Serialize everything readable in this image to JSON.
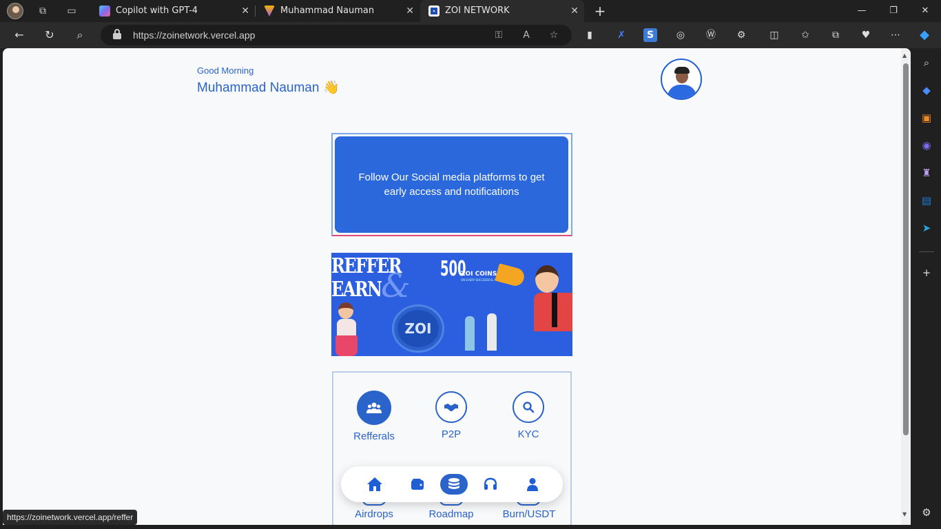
{
  "browser": {
    "tabs": [
      {
        "title": "Copilot with GPT-4",
        "favicon_color": "#7b6cf0"
      },
      {
        "title": "Muhammad Nauman",
        "favicon_color": "#a35ad6"
      },
      {
        "title": "ZOI NETWORK",
        "favicon_color": "#1e4fb8",
        "active": true
      }
    ],
    "address": {
      "url": "https://zoinetwork.vercel.app"
    },
    "status_url": "https://zoinetwork.vercel.app/reffer"
  },
  "header": {
    "greeting": "Good Morning",
    "username": "Muhammad Nauman",
    "wave_emoji": "👋"
  },
  "social": {
    "message": "Follow Our Social media platforms to get early access and notifications"
  },
  "banner": {
    "line1": "REFFER",
    "line2": "EARN",
    "amount": "500",
    "coins_label": "ZOI COINS",
    "coin_text": "ZOI",
    "sub": "ON EVERY SUCCESSFUL REFERRAL FRIEND"
  },
  "menu": {
    "items": [
      {
        "label": "Refferals",
        "icon": "users-icon"
      },
      {
        "label": "P2P",
        "icon": "handshake-icon"
      },
      {
        "label": "KYC",
        "icon": "search-icon"
      }
    ],
    "row2": [
      {
        "label": "Airdrops"
      },
      {
        "label": "Roadmap"
      },
      {
        "label": "Burn/USDT"
      }
    ]
  },
  "bottom_nav": [
    {
      "icon": "home-icon"
    },
    {
      "icon": "wallet-icon"
    },
    {
      "icon": "coins-icon",
      "active": true
    },
    {
      "icon": "headset-icon"
    },
    {
      "icon": "user-icon"
    }
  ],
  "colors": {
    "accent": "#2a63c9",
    "card": "#2a68dc",
    "banner": "#2b5fe0"
  }
}
